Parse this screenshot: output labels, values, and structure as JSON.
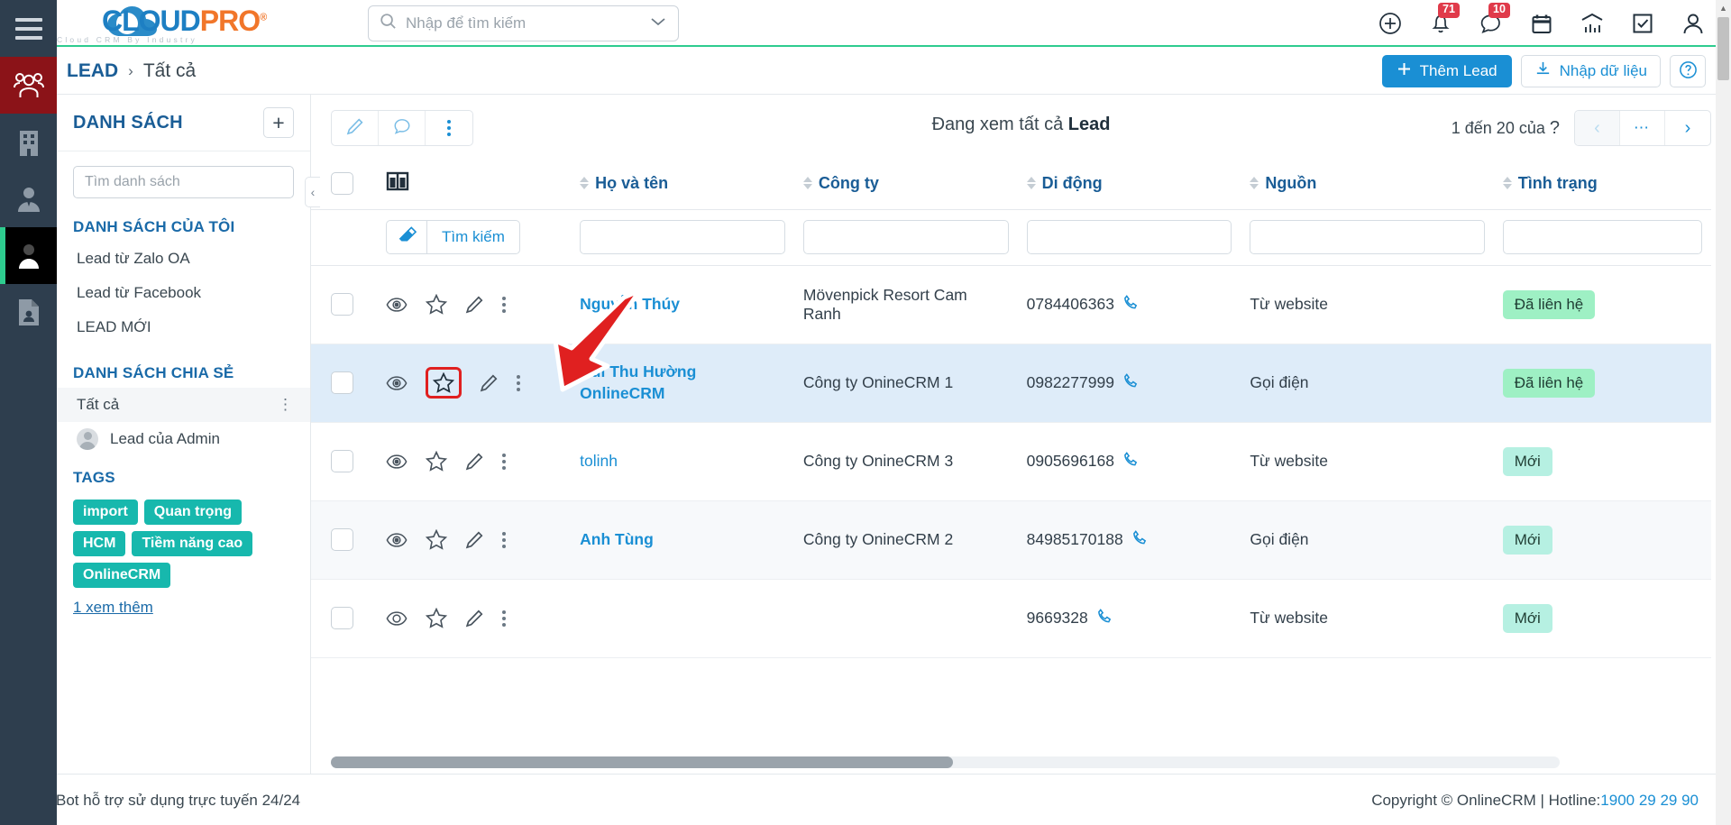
{
  "brand": {
    "name_part1": "CLOUD",
    "name_part2": "PRO",
    "registered": "®",
    "tagline": "Cloud CRM By Industry",
    "color_blue": "#1d7fc3",
    "color_orange": "#f1762a"
  },
  "topbar": {
    "search_placeholder": "Nhập để tìm kiếm",
    "search_icon": "search-icon",
    "dropdown_icon": "chevron-down-icon",
    "icons": [
      {
        "name": "add-circle-icon",
        "badge": ""
      },
      {
        "name": "bell-icon",
        "badge": "71"
      },
      {
        "name": "chat-icon",
        "badge": "10"
      },
      {
        "name": "calendar-icon",
        "badge": ""
      },
      {
        "name": "analytics-icon",
        "badge": ""
      },
      {
        "name": "task-checkbox-icon",
        "badge": ""
      },
      {
        "name": "user-account-icon",
        "badge": ""
      }
    ]
  },
  "rail": {
    "menu_icon": "hamburger-menu-icon",
    "items": [
      {
        "name": "contacts-group-icon",
        "state": "active-red"
      },
      {
        "name": "company-building-icon",
        "state": "normal"
      },
      {
        "name": "person-tie-icon",
        "state": "normal"
      },
      {
        "name": "lead-person-icon",
        "state": "active-black"
      },
      {
        "name": "document-person-icon",
        "state": "normal"
      }
    ]
  },
  "subheader": {
    "breadcrumb_root": "LEAD",
    "breadcrumb_sep": "›",
    "breadcrumb_current": "Tất cả",
    "add_lead_label": "Thêm Lead",
    "add_lead_icon": "plus-icon",
    "import_label": "Nhập dữ liệu",
    "import_icon": "download-import-icon",
    "help_icon": "help-circle-icon",
    "accent": "#1a8fd4"
  },
  "leftpanel": {
    "title": "DANH SÁCH",
    "add_icon": "plus-icon",
    "search_placeholder": "Tìm danh sách",
    "my_lists_title": "DANH SÁCH CỦA TÔI",
    "my_lists": [
      {
        "label": "Lead từ Zalo OA"
      },
      {
        "label": "Lead từ Facebook"
      },
      {
        "label": "LEAD MỚI"
      }
    ],
    "shared_lists_title": "DANH SÁCH CHIA SẺ",
    "shared_selected": "Tất cả",
    "shared_selected_menu": "⋮",
    "shared_user": "Lead của Admin",
    "tags_title": "TAGS",
    "tags": [
      "import",
      "Quan trọng",
      "HCM",
      "Tiềm năng cao",
      "OnlineCRM"
    ],
    "tag_color": "#17b8ad",
    "more_link": "1  xem thêm",
    "collapse_icon": "chevron-left-icon"
  },
  "toolbar": {
    "buttons": [
      {
        "name": "edit-pencil-icon"
      },
      {
        "name": "comment-icon"
      },
      {
        "name": "more-vertical-icon"
      }
    ],
    "title_prefix": "Đang xem tất cả ",
    "title_strong": "Lead",
    "pager_text": "1 đến 20 của",
    "pager_unknown": "?",
    "prev_icon": "chevron-left-icon",
    "more_icon": "ellipsis-icon",
    "next_icon": "chevron-right-icon"
  },
  "table": {
    "select_all_name": "select-all-checkbox",
    "column_chooser_icon": "column-layout-icon",
    "columns": [
      {
        "label": "Họ và tên",
        "sortable": true
      },
      {
        "label": "Công ty",
        "sortable": true
      },
      {
        "label": "Di động",
        "sortable": true
      },
      {
        "label": "Nguồn",
        "sortable": true
      },
      {
        "label": "Tình trạng",
        "sortable": true
      }
    ],
    "filter": {
      "eraser_icon": "eraser-icon",
      "search_label": "Tìm kiếm",
      "inputs": [
        "",
        "",
        "",
        "",
        ""
      ]
    },
    "row_actions": [
      "view-eye-icon",
      "favorite-star-icon",
      "edit-pencil-icon",
      "more-vertical-icon"
    ],
    "rows": [
      {
        "name": "Nguyễn Thúy",
        "company": "Mövenpick Resort Cam Ranh",
        "phone": "0784406363",
        "phone_icon": "phone-call-icon",
        "source": "Từ website",
        "status": "Đã liên hệ",
        "status_style": "green",
        "highlighted": false,
        "starred_highlight": false
      },
      {
        "name": "Bùi Thu Hường OnlineCRM",
        "company": "Công ty OnineCRM 1",
        "phone": "0982277999",
        "phone_icon": "phone-call-icon",
        "source": "Gọi điện",
        "status": "Đã liên hệ",
        "status_style": "green",
        "highlighted": true,
        "starred_highlight": true
      },
      {
        "name": "tolinh",
        "company": "Công ty OnineCRM 3",
        "phone": "0905696168",
        "phone_icon": "phone-call-icon",
        "source": "Từ website",
        "status": "Mới",
        "status_style": "mint",
        "highlighted": false,
        "starred_highlight": false
      },
      {
        "name": "Anh Tùng",
        "company": "Công ty OnineCRM 2",
        "phone": "84985170188",
        "phone_icon": "phone-call-icon",
        "source": "Gọi điện",
        "status": "Mới",
        "status_style": "mint",
        "highlighted": false,
        "starred_highlight": false
      },
      {
        "name": "",
        "company": "",
        "phone": "9669328",
        "phone_icon": "phone-call-icon",
        "source": "Từ website",
        "status": "Mới",
        "status_style": "mint",
        "highlighted": false,
        "starred_highlight": false
      }
    ]
  },
  "annotation": {
    "arrow_color": "#e02020",
    "highlight_target": "favorite-star-icon"
  },
  "footer": {
    "bot_icon": "messenger-bot-icon",
    "bot_text": "Bot hỗ trợ sử dụng trực tuyến 24/24",
    "copyright": "Copyright © OnlineCRM | Hotline: ",
    "hotline": "1900 29 29 90"
  }
}
